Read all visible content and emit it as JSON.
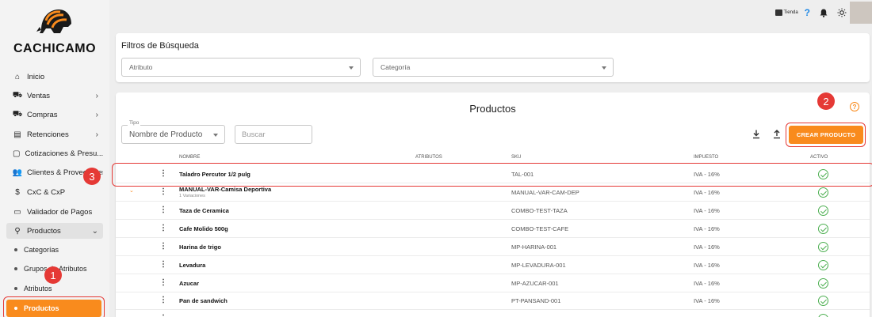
{
  "app": {
    "logo_text": "CACHICAMO"
  },
  "sidebar": {
    "items": [
      {
        "label": "Inicio",
        "icon": "home-icon"
      },
      {
        "label": "Ventas",
        "icon": "cart-icon"
      },
      {
        "label": "Compras",
        "icon": "cart-icon"
      },
      {
        "label": "Retenciones",
        "icon": "receipt-icon"
      },
      {
        "label": "Cotizaciones & Presu...",
        "icon": "document-icon"
      },
      {
        "label": "Clientes & Proveedores",
        "icon": "people-icon"
      },
      {
        "label": "CxC & CxP",
        "icon": "money-icon"
      },
      {
        "label": "Validador de Pagos",
        "icon": "card-icon"
      },
      {
        "label": "Productos",
        "icon": "tag-icon"
      }
    ],
    "sub_items": [
      "Categorías",
      "Grupos de Atributos",
      "Atributos",
      "Productos"
    ]
  },
  "topbar": {
    "store_label": "Tienda",
    "help_label": "?"
  },
  "filters": {
    "title": "Filtros de Búsqueda",
    "attribute_placeholder": "Atributo",
    "category_placeholder": "Categoría"
  },
  "products": {
    "title": "Productos",
    "type_legend": "Tipo",
    "type_value": "Nombre de Producto",
    "search_placeholder": "Buscar",
    "create_button": "CREAR PRODUCTO",
    "panel_help": "?",
    "columns": {
      "name": "NOMBRE",
      "attributes": "ATRIBUTOS",
      "sku": "SKU",
      "tax": "IMPUESTO",
      "active": "ACTIVO"
    },
    "rows": [
      {
        "name": "Taladro Percutor 1/2 pulg",
        "sub": "",
        "sku": "TAL-001",
        "tax": "IVA - 16%",
        "expand": ""
      },
      {
        "name": "MANUAL-VAR-Camisa Deportiva",
        "sub": "1 Variaciones",
        "sku": "MANUAL-VAR-CAM-DEP",
        "tax": "IVA - 16%",
        "expand": "⌄"
      },
      {
        "name": "Taza de Ceramica",
        "sub": "",
        "sku": "COMBO-TEST-TAZA",
        "tax": "IVA - 16%",
        "expand": ""
      },
      {
        "name": "Cafe Molido 500g",
        "sub": "",
        "sku": "COMBO-TEST-CAFE",
        "tax": "IVA - 16%",
        "expand": ""
      },
      {
        "name": "Harina de trigo",
        "sub": "",
        "sku": "MP-HARINA-001",
        "tax": "IVA - 16%",
        "expand": ""
      },
      {
        "name": "Levadura",
        "sub": "",
        "sku": "MP-LEVADURA-001",
        "tax": "IVA - 16%",
        "expand": ""
      },
      {
        "name": "Azucar",
        "sub": "",
        "sku": "MP-AZUCAR-001",
        "tax": "IVA - 16%",
        "expand": ""
      },
      {
        "name": "Pan de sandwich",
        "sub": "",
        "sku": "PT-PANSAND-001",
        "tax": "IVA - 16%",
        "expand": ""
      }
    ]
  },
  "annotations": [
    "1",
    "2",
    "3"
  ],
  "colors": {
    "accent": "#f98b1d",
    "highlight": "#e53935",
    "active_check": "#4caf50"
  }
}
